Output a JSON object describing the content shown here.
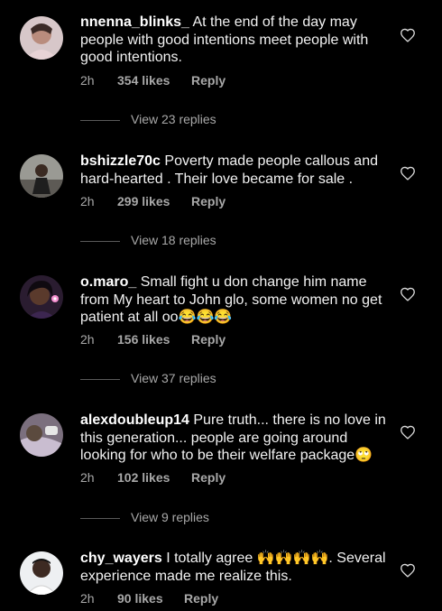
{
  "comments": [
    {
      "username": "nnenna_blinks_",
      "text": "At the end of the day may people with good intentions meet people with good intentions.",
      "time": "2h",
      "likes": "354 likes",
      "reply": "Reply",
      "view_replies": "View 23 replies",
      "avatar_icon": "profile-avatar"
    },
    {
      "username": "bshizzle70c",
      "text": "Poverty made people callous and hard-hearted . Their love became for sale .",
      "time": "2h",
      "likes": "299 likes",
      "reply": "Reply",
      "view_replies": "View 18 replies",
      "avatar_icon": "profile-avatar"
    },
    {
      "username": "o.maro_",
      "text": "Small fight u don change him name from My heart to John glo, some women no get patient at all oo😂😂😂",
      "time": "2h",
      "likes": "156 likes",
      "reply": "Reply",
      "view_replies": "View 37 replies",
      "avatar_icon": "profile-avatar"
    },
    {
      "username": "alexdoubleup14",
      "text": "Pure truth... there is no love in this generation... people are going around looking for who to be their welfare package🙄",
      "time": "2h",
      "likes": "102 likes",
      "reply": "Reply",
      "view_replies": "View 9 replies",
      "avatar_icon": "profile-avatar"
    },
    {
      "username": "chy_wayers",
      "text": "I totally agree 🙌🙌🙌🙌. Several experience made me realize this.",
      "time": "2h",
      "likes": "90 likes",
      "reply": "Reply",
      "avatar_icon": "profile-avatar"
    }
  ],
  "colors": {
    "background": "#000000",
    "text": "#f2f2f2",
    "muted": "#a8a8a8"
  },
  "icons": {
    "like": "heart-outline-icon"
  }
}
